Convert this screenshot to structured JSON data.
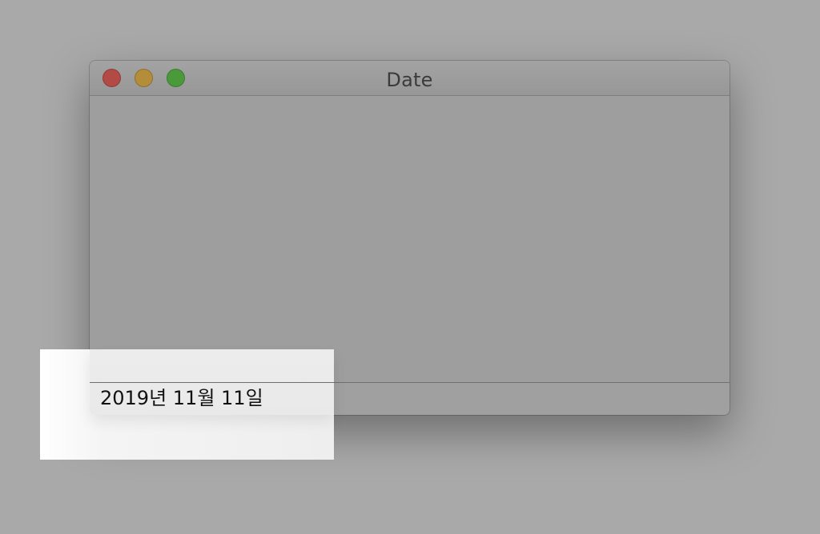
{
  "window": {
    "title": "Date"
  },
  "status": {
    "date": "2019년 11월 11일"
  },
  "controls": {
    "close_icon": "close-icon",
    "minimize_icon": "minimize-icon",
    "zoom_icon": "zoom-icon"
  },
  "colors": {
    "background": "#a9a9a9",
    "window": "#9f9f9f",
    "highlight": "#eeeeee",
    "close": "#b24a45",
    "minimize": "#b48d3a",
    "zoom": "#4a9a3c"
  }
}
